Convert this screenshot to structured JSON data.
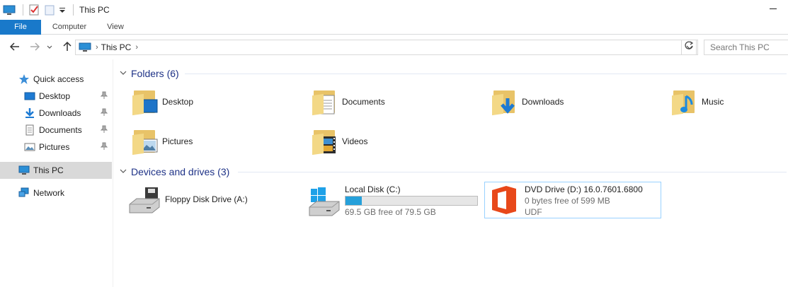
{
  "window": {
    "title": "This PC"
  },
  "ribbon": {
    "tabs": [
      {
        "label": "File"
      },
      {
        "label": "Computer"
      },
      {
        "label": "View"
      }
    ]
  },
  "address": {
    "path": [
      "This PC"
    ],
    "search_placeholder": "Search This PC"
  },
  "sidebar": {
    "items": [
      {
        "label": "Quick access",
        "icon": "star-icon"
      },
      {
        "label": "Desktop",
        "icon": "desktop-icon",
        "pinned": true
      },
      {
        "label": "Downloads",
        "icon": "download-icon",
        "pinned": true
      },
      {
        "label": "Documents",
        "icon": "documents-icon",
        "pinned": true
      },
      {
        "label": "Pictures",
        "icon": "pictures-icon",
        "pinned": true
      },
      {
        "label": "This PC",
        "icon": "computer-icon",
        "selected": true
      },
      {
        "label": "Network",
        "icon": "network-icon"
      }
    ]
  },
  "folders": {
    "header": "Folders (6)",
    "items": [
      {
        "label": "Desktop",
        "icon": "desktop-folder-icon"
      },
      {
        "label": "Documents",
        "icon": "documents-folder-icon"
      },
      {
        "label": "Downloads",
        "icon": "downloads-folder-icon"
      },
      {
        "label": "Music",
        "icon": "music-folder-icon"
      },
      {
        "label": "Pictures",
        "icon": "pictures-folder-icon"
      },
      {
        "label": "Videos",
        "icon": "videos-folder-icon"
      }
    ]
  },
  "drives": {
    "header": "Devices and drives (3)",
    "items": [
      {
        "name": "Floppy Disk Drive (A:)",
        "icon": "floppy-drive-icon"
      },
      {
        "name": "Local Disk (C:)",
        "icon": "windows-drive-icon",
        "free_text": "69.5 GB free of 79.5 GB",
        "used_fraction": 0.126
      },
      {
        "name": "DVD Drive (D:) 16.0.7601.6800",
        "icon": "office-dvd-icon",
        "free_text": "0 bytes free of 599 MB",
        "fs": "UDF"
      }
    ]
  },
  "colors": {
    "accent": "#1979ca",
    "bar_fill": "#26a0da",
    "group_title": "#1e3287",
    "selection_border": "#99d1ff"
  }
}
